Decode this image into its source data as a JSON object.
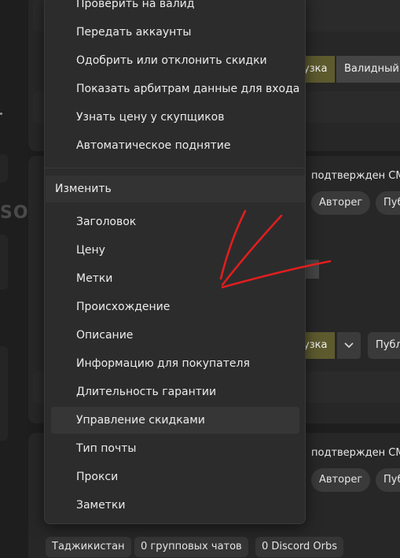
{
  "background": {
    "ghost_text": "SO",
    "row1": {
      "tags": [
        "узка",
        "Валидный"
      ]
    },
    "row2": {
      "title": "подтвержден СМ",
      "chips": [
        "Авторег",
        "Пуб"
      ]
    },
    "row3": {
      "tags": [
        "узка",
        "Публ"
      ]
    },
    "row4": {
      "title": "подтвержден СМ",
      "chips": [
        "Авторег",
        "Пуб"
      ]
    },
    "bottom_chips": [
      "Таджикистан",
      "0 групповых чатов",
      "0 Discord Orbs"
    ]
  },
  "menu": {
    "top_items": [
      "Проверить на валид",
      "Передать аккаунты",
      "Одобрить или отклонить скидки",
      "Показать арбитрам данные для входа",
      "Узнать цену у скупщиков",
      "Автоматическое поднятие"
    ],
    "section_label": "Изменить",
    "edit_items": [
      "Заголовок",
      "Цену",
      "Метки",
      "Происхождение",
      "Описание",
      "Информацию для покупателя",
      "Длительность гарантии",
      "Управление скидками",
      "Тип почты",
      "Прокси",
      "Заметки"
    ],
    "hovered_item": "Управление скидками"
  },
  "colors": {
    "annotation": "#e01e1e",
    "olive_tag": "#5d5a2e",
    "menu_bg": "#2c2c2c"
  }
}
